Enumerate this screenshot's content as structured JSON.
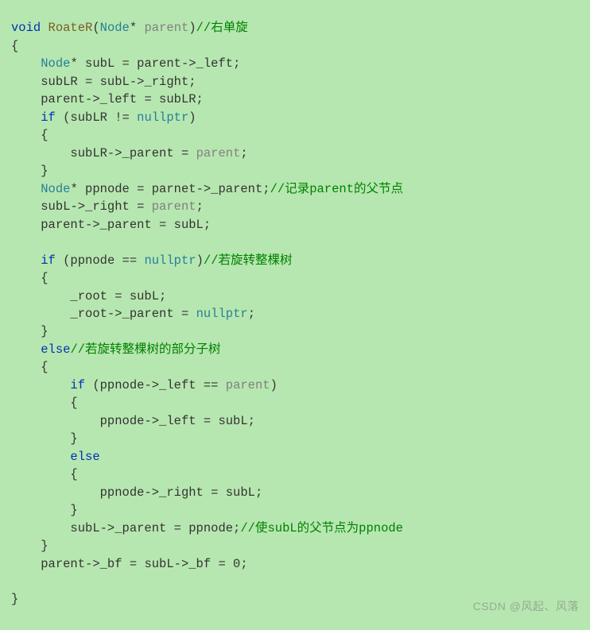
{
  "code": {
    "fn_sig_void": "void",
    "fn_name": "RoateR",
    "fn_param_type": "Node",
    "fn_param_star": "*",
    "fn_param_name": "parent",
    "cm_fn": "//右单旋",
    "l_open": "{",
    "l1_type": "Node",
    "l1": "* subL = parent->_left;",
    "l2": "subLR = subL->_right;",
    "l3": "parent->_left = subLR;",
    "l4_if": "if",
    "l4_cond": " (subLR != ",
    "l4_null": "nullptr",
    "l4_end": ")",
    "l5": "{",
    "l6": "subLR->_parent = ",
    "l6_p": "parent",
    "l6_end": ";",
    "l7": "}",
    "l8_type": "Node",
    "l8": "* ppnode = parnet->_parent;",
    "cm_l8": "//记录parent的父节点",
    "l9": "subL->_right = ",
    "l9_p": "parent",
    "l9_end": ";",
    "l10": "parent->_parent = subL;",
    "l11_if": "if",
    "l11_cond": " (ppnode == ",
    "l11_null": "nullptr",
    "l11_end": ")",
    "cm_l11": "//若旋转整棵树",
    "l12": "{",
    "l13": "_root = subL;",
    "l14": "_root->_parent = ",
    "l14_null": "nullptr",
    "l14_end": ";",
    "l15": "}",
    "l16_else": "else",
    "cm_l16": "//若旋转整棵树的部分子树",
    "l17": "{",
    "l18_if": "if",
    "l18_cond": " (ppnode->_left == ",
    "l18_p": "parent",
    "l18_end": ")",
    "l19": "{",
    "l20": "ppnode->_left = subL;",
    "l21": "}",
    "l22_else": "else",
    "l23": "{",
    "l24": "ppnode->_right = subL;",
    "l25": "}",
    "l26": "subL->_parent = ppnode;",
    "cm_l26": "//使subL的父节点为ppnode",
    "l27": "}",
    "l28": "parent->_bf = subL->_bf = 0;",
    "l_close": "}",
    "watermark": "CSDN @风起、风落"
  }
}
